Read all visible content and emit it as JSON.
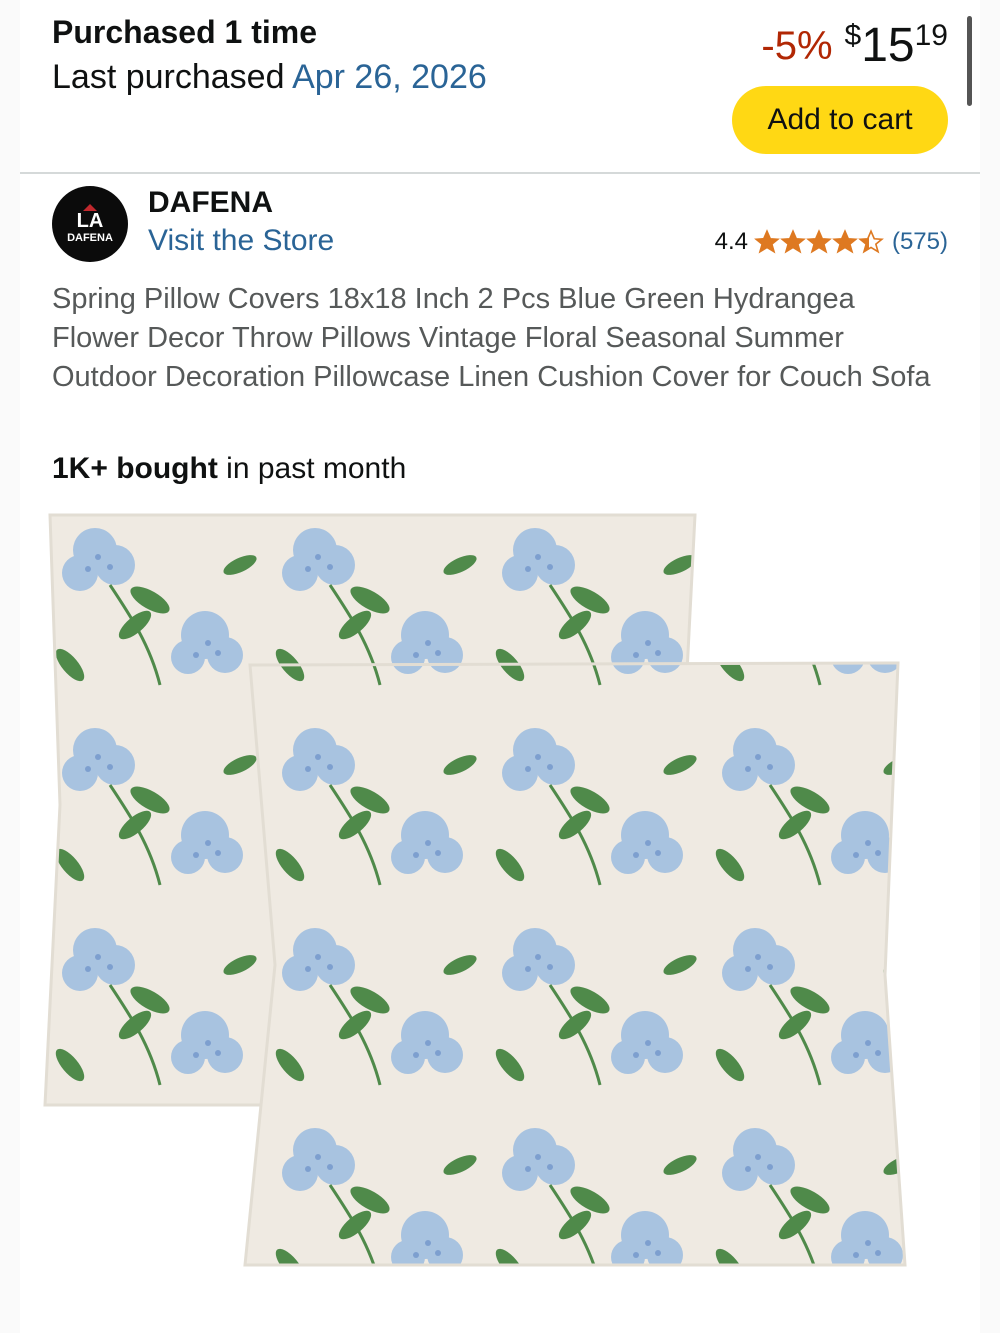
{
  "purchase": {
    "count_label": "Purchased 1 time",
    "last_label": "Last purchased ",
    "last_date": "Apr 26, 2026"
  },
  "price": {
    "discount": "-5%",
    "symbol": "$",
    "whole": "15",
    "fraction": "19"
  },
  "cart_button": "Add to cart",
  "brand": {
    "logo_mark": "LA",
    "logo_text": "DAFENA",
    "name": "DAFENA",
    "store_link": "Visit the Store"
  },
  "rating": {
    "value": "4.4",
    "stars": 4.4,
    "count": "(575)"
  },
  "product": {
    "title": "Spring Pillow Covers 18x18 Inch 2 Pcs Blue Green Hydrangea Flower Decor Throw Pillows Vintage Floral Seasonal Summer Outdoor Decoration Pillowcase Linen Cushion Cover for Couch Sofa",
    "bought_bold": "1K+ bought",
    "bought_rest": " in past month"
  },
  "colors": {
    "link": "#2a6496",
    "discount": "#b12704",
    "button": "#ffd814",
    "star": "#de7921"
  }
}
